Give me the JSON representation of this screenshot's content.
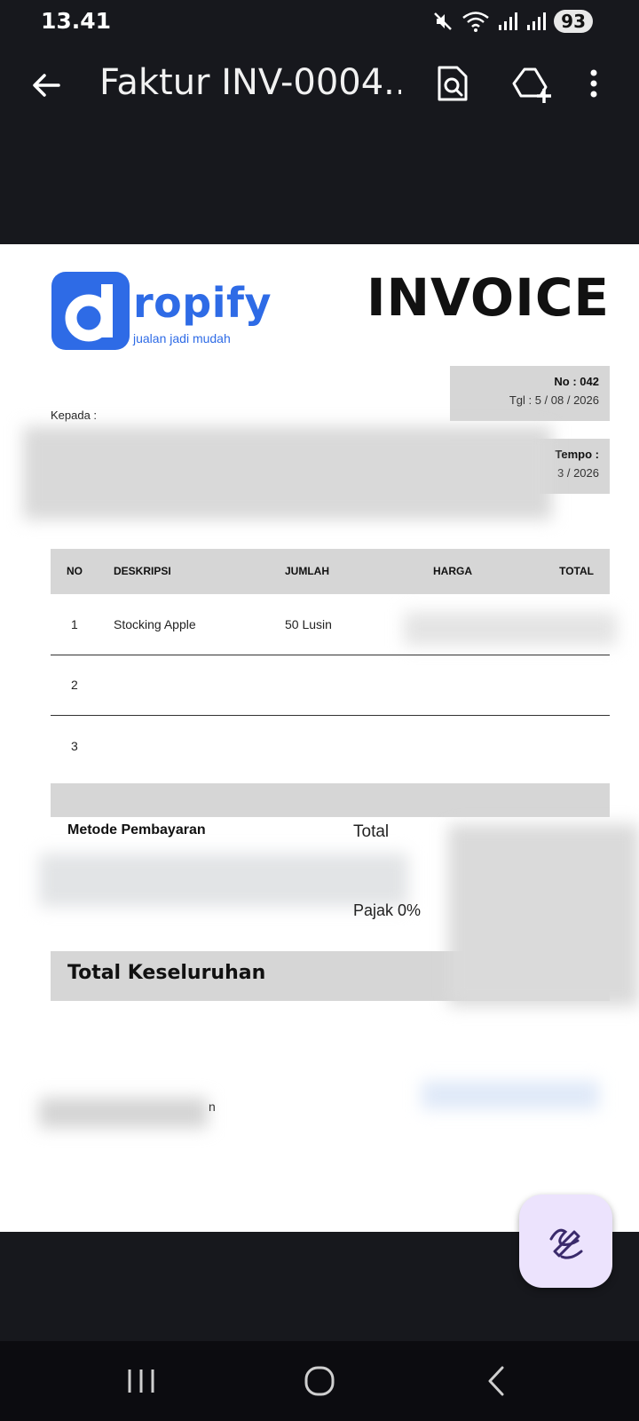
{
  "status_bar": {
    "time": "13.41",
    "battery": "93"
  },
  "app_bar": {
    "title": "Faktur INV-0004..."
  },
  "invoice": {
    "logo": {
      "letter": "d",
      "word": "ropify",
      "tagline": "jualan jadi mudah"
    },
    "heading": "INVOICE",
    "number_label": "No : 042",
    "date_label": "Tgl : 5 / 08 / 2026",
    "due_label": "Tempo :",
    "due_value_fragment": "3 / 2026",
    "recipient_label": "Kepada :",
    "table": {
      "headers": [
        "NO",
        "DESKRIPSI",
        "JUMLAH",
        "HARGA",
        "TOTAL"
      ],
      "rows": [
        {
          "no": "1",
          "description": "Stocking Apple",
          "qty": "50 Lusin"
        },
        {
          "no": "2",
          "description": "",
          "qty": ""
        },
        {
          "no": "3",
          "description": "",
          "qty": ""
        }
      ]
    },
    "payment_method_label": "Metode Pembayaran",
    "total_label": "Total",
    "tax_label": "Pajak 0%",
    "grand_total_label": "Total Keseluruhan",
    "signature_fragment": "n"
  },
  "colors": {
    "brand": "#2e6be6",
    "fab_bg": "#ece3fd",
    "fab_icon": "#3a2a6b"
  }
}
